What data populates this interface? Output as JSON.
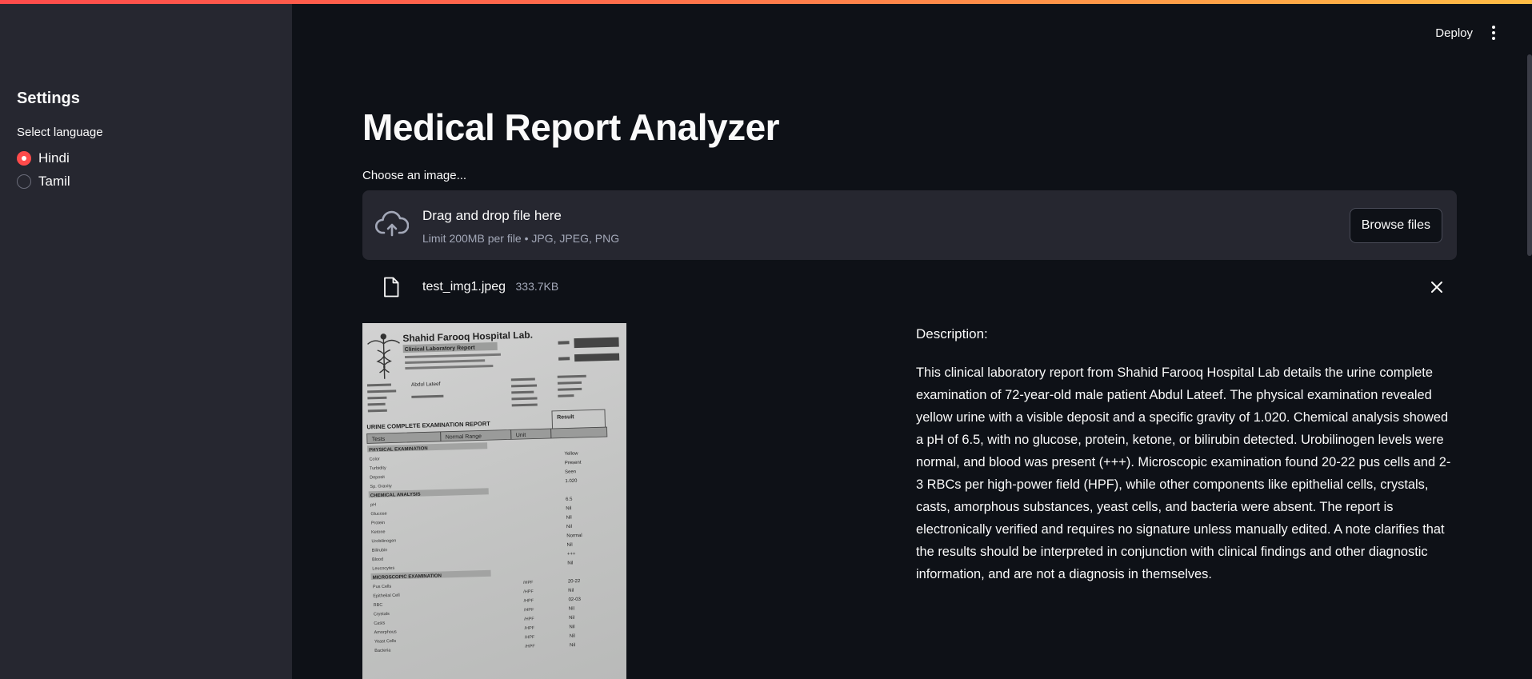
{
  "header": {
    "deploy_label": "Deploy",
    "menu_icon": "kebab-menu-icon"
  },
  "sidebar": {
    "title": "Settings",
    "language_label": "Select language",
    "options": [
      {
        "label": "Hindi",
        "selected": true
      },
      {
        "label": "Tamil",
        "selected": false
      }
    ]
  },
  "main": {
    "title": "Medical Report Analyzer",
    "uploader": {
      "label": "Choose an image...",
      "drop_title": "Drag and drop file here",
      "drop_hint": "Limit 200MB per file • JPG, JPEG, PNG",
      "browse_label": "Browse files",
      "icon": "cloud-upload-icon"
    },
    "file": {
      "name": "test_img1.jpeg",
      "size": "333.7KB",
      "icon": "file-icon"
    },
    "image": {
      "lab_name": "Shahid Farooq Hospital Lab.",
      "subtitle": "Clinical Laboratory Report",
      "patient": "Abdul Lateef",
      "report_title": "URINE COMPLETE EXAMINATION REPORT",
      "columns": [
        "Tests",
        "Normal Range",
        "Unit",
        "Result"
      ],
      "rows": [
        {
          "test": "PHYSICAL EXAMINATION",
          "section": true
        },
        {
          "test": "Color",
          "result": "Yellow"
        },
        {
          "test": "Turbidity",
          "result": "Present"
        },
        {
          "test": "Deposit",
          "result": "Seen"
        },
        {
          "test": "Sp. Gravity",
          "result": "1.020"
        },
        {
          "test": "CHEMICAL ANALYSIS",
          "section": true
        },
        {
          "test": "pH",
          "result": "6.5"
        },
        {
          "test": "Glucose",
          "result": "Nil"
        },
        {
          "test": "Protein",
          "result": "Nil"
        },
        {
          "test": "Ketone",
          "result": "Nil"
        },
        {
          "test": "Urobilinogen",
          "result": "Normal"
        },
        {
          "test": "Bilirubin",
          "result": "Nil"
        },
        {
          "test": "Blood",
          "result": "+++"
        },
        {
          "test": "Leucocytes",
          "result": "Nil"
        },
        {
          "test": "MICROSCOPIC EXAMINATION",
          "section": true
        },
        {
          "test": "Pus Cells",
          "unit": "/HPF",
          "result": "20-22"
        },
        {
          "test": "Epithelial Cell",
          "unit": "/HPF",
          "result": "Nil"
        },
        {
          "test": "RBC",
          "unit": "/HPF",
          "result": "02-03"
        },
        {
          "test": "Crystals",
          "unit": "/HPF",
          "result": "Nil"
        },
        {
          "test": "Casts",
          "unit": "/HPF",
          "result": "Nil"
        },
        {
          "test": "Amorphous",
          "unit": "/HPF",
          "result": "Nil"
        },
        {
          "test": "Yeast Cells",
          "unit": "/HPF",
          "result": "Nil"
        },
        {
          "test": "Bacteria",
          "unit": "/HPF",
          "result": "Nil"
        }
      ]
    },
    "description": {
      "heading": "Description:",
      "text": "This clinical laboratory report from Shahid Farooq Hospital Lab details the urine complete examination of 72-year-old male patient Abdul Lateef. The physical examination revealed yellow urine with a visible deposit and a specific gravity of 1.020. Chemical analysis showed a pH of 6.5, with no glucose, protein, ketone, or bilirubin detected. Urobilinogen levels were normal, and blood was present (+++). Microscopic examination found 20-22 pus cells and 2-3 RBCs per high-power field (HPF), while other components like epithelial cells, crystals, casts, amorphous substances, yeast cells, and bacteria were absent. The report is electronically verified and requires no signature unless manually edited. A note clarifies that the results should be interpreted in conjunction with clinical findings and other diagnostic information, and are not a diagnosis in themselves."
    }
  },
  "colors": {
    "background": "#0e1117",
    "sidebar": "#262730",
    "accent": "#ff4b4b",
    "text": "#fafafa",
    "muted": "#a3a8b8"
  }
}
